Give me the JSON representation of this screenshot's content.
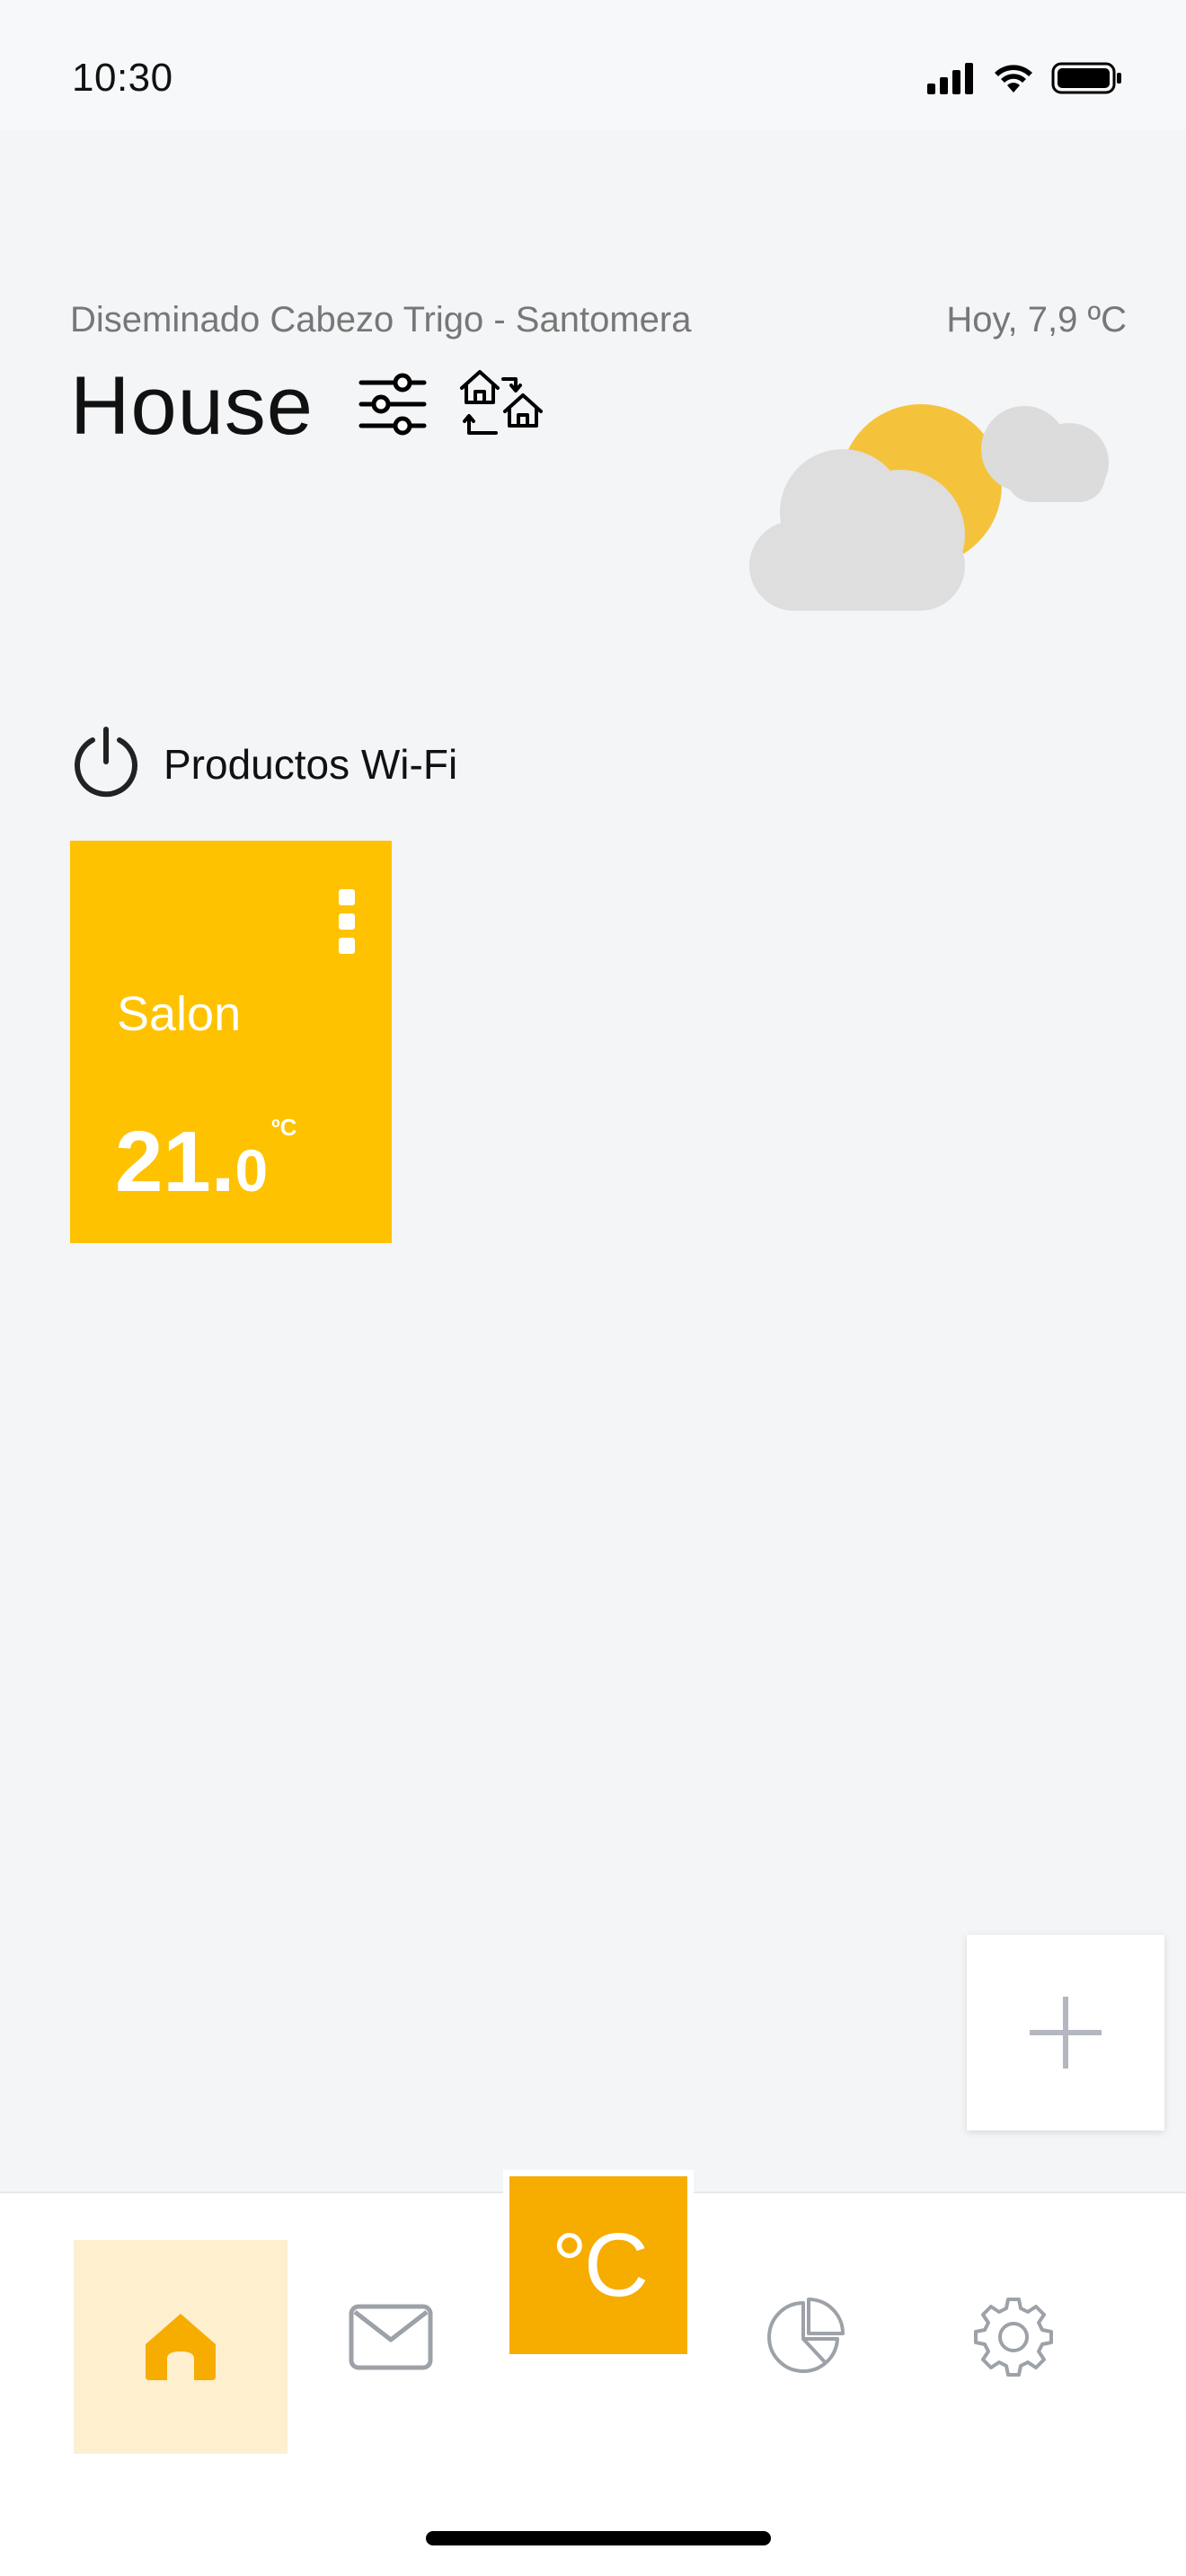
{
  "status_bar": {
    "time": "10:30",
    "icons": [
      "signal-icon",
      "wifi-icon",
      "battery-icon"
    ]
  },
  "header": {
    "location": "Diseminado Cabezo Trigo - Santomera",
    "today_temp": "Hoy, 7,9 ºC",
    "title": "House",
    "filters_icon": "sliders-icon",
    "switch_home_icon": "switch-home-icon",
    "weather_icon": "partly-cloudy-icon"
  },
  "section": {
    "power_icon": "power-icon",
    "title": "Productos Wi-Fi"
  },
  "devices": [
    {
      "name": "Salon",
      "temp_integer": "21.",
      "temp_decimal": "0",
      "temp_unit": "ºC",
      "color": "#fec200"
    }
  ],
  "add_button": {
    "icon": "plus-icon"
  },
  "bottom_nav": {
    "items": [
      {
        "name": "home",
        "icon": "home-icon",
        "active": true
      },
      {
        "name": "messages",
        "icon": "mail-icon",
        "active": false
      },
      {
        "name": "temperature",
        "label": "°C",
        "active": false
      },
      {
        "name": "statistics",
        "icon": "pie-chart-icon",
        "active": false
      },
      {
        "name": "settings",
        "icon": "gear-icon",
        "active": false
      }
    ]
  },
  "colors": {
    "accent": "#f7ac00",
    "card": "#fec200",
    "active_nav_bg": "#fef0cf",
    "background": "#f4f5f7"
  }
}
